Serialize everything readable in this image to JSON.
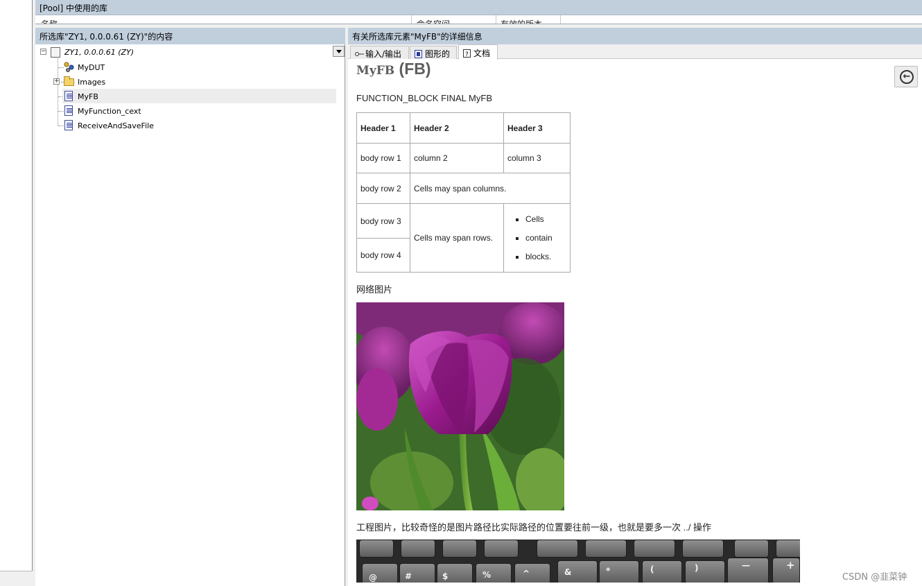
{
  "pool_panel": {
    "title": "[Pool] 中使用的库",
    "columns": [
      "名称",
      "命名空间",
      "有效的版本"
    ]
  },
  "library_panel": {
    "title": "所选库\"ZY1, 0.0.0.61 (ZY)\"的内容",
    "root": "ZY1, 0.0.0.61 (ZY)",
    "items": [
      {
        "label": "MyDUT",
        "icon": "dut-icon"
      },
      {
        "label": "Images",
        "icon": "folder-icon"
      },
      {
        "label": "MyFB",
        "icon": "pou-document-icon",
        "selected": true
      },
      {
        "label": "MyFunction_cext",
        "icon": "pou-document-icon"
      },
      {
        "label": "ReceiveAndSaveFile",
        "icon": "pou-document-icon"
      }
    ]
  },
  "details_panel": {
    "title": "有关所选库元素\"MyFB\"的详细信息",
    "tabs": [
      {
        "label": "输入/输出",
        "icon": "io-icon"
      },
      {
        "label": "图形的",
        "icon": "graphic-icon"
      },
      {
        "label": "文档",
        "icon": "help-icon",
        "active": true
      }
    ],
    "doc": {
      "title_name": "MyFB",
      "title_kind": "(FB)",
      "declaration": "FUNCTION_BLOCK FINAL MyFB",
      "table": {
        "headers": [
          "Header 1",
          "Header 2",
          "Header 3"
        ],
        "row1": [
          "body row 1",
          "column 2",
          "column 3"
        ],
        "row2": [
          "body row 2",
          "Cells may span columns."
        ],
        "row3_label": "body row 3",
        "row4_label": "body row 4",
        "span_rows": "Cells may span rows.",
        "bullets": [
          "Cells",
          "contain",
          "blocks."
        ]
      },
      "image1_caption": "网络图片",
      "image2_caption": "工程图片，比较奇怪的是图片路径比实际路径的位置要往前一级，也就是要多一次 ../ 操作",
      "keyboard_keys": [
        "@",
        "#",
        "$",
        "%",
        "^",
        "&",
        "*",
        "(",
        ")",
        "—",
        "+"
      ]
    }
  },
  "watermark": "CSDN @韭菜钟",
  "colors": {
    "panel_header": "#c1cfdd",
    "selection": "#ededed",
    "tulip": "#9b1e8e"
  }
}
